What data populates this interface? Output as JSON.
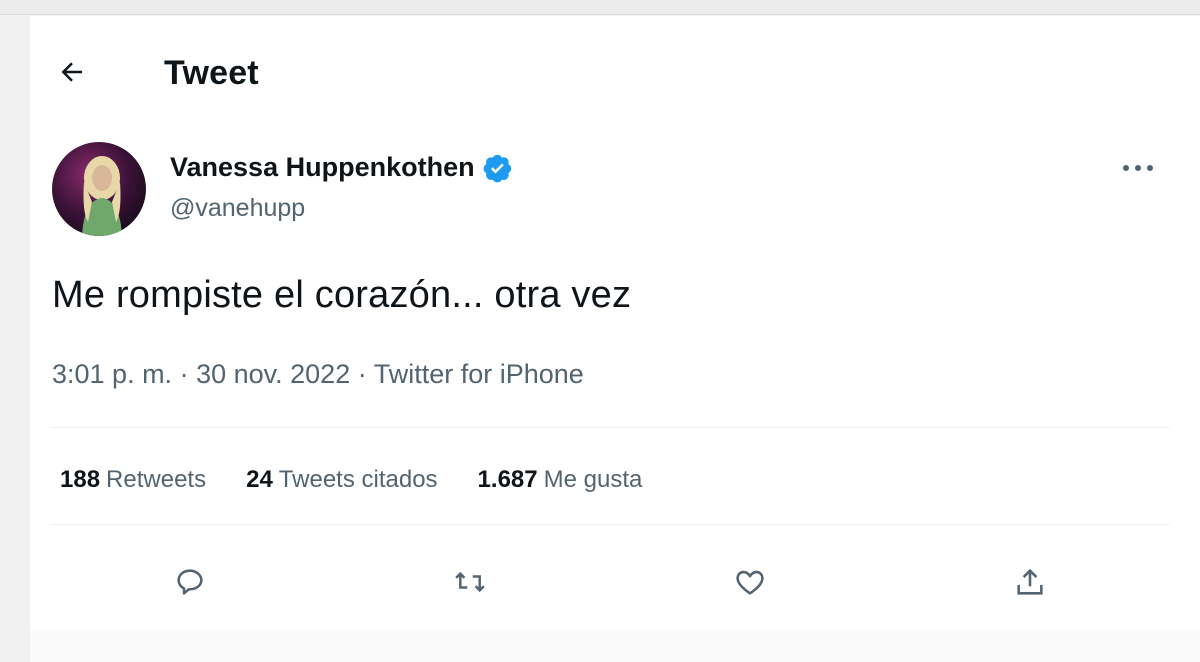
{
  "header": {
    "title": "Tweet",
    "back_icon": "arrow-left-icon"
  },
  "tweet": {
    "author_name": "Vanessa Huppenkothen",
    "author_handle": "@vanehupp",
    "verified_color": "#1d9bf0",
    "text": "Me rompiste el corazón... otra vez",
    "time": "3:01 p. m.",
    "separator": " · ",
    "date": "30 nov. 2022",
    "source": "Twitter for iPhone"
  },
  "stats": {
    "retweets_count": "188",
    "retweets_label": "Retweets",
    "quotes_count": "24",
    "quotes_label": "Tweets citados",
    "likes_count": "1.687",
    "likes_label": "Me gusta"
  },
  "actions": [
    "reply-icon",
    "retweet-icon",
    "like-icon",
    "share-icon"
  ],
  "colors": {
    "text": "#0f1419",
    "secondary": "#536471",
    "accent": "#1d9bf0"
  }
}
